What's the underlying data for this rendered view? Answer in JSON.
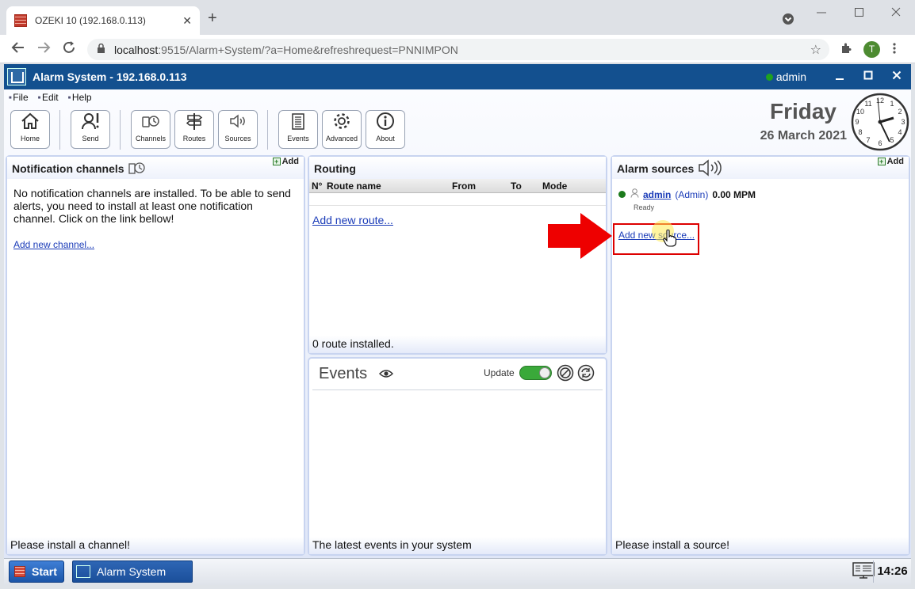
{
  "browser": {
    "tab_title": "OZEKI 10 (192.168.0.113)",
    "tab_close": "✕",
    "new_tab": "+",
    "url_host": "localhost",
    "url_rest": ":9515/Alarm+System/?a=Home&refreshrequest=PNNIMPON",
    "profile_initial": "T"
  },
  "app": {
    "title": "Alarm System - 192.168.0.113",
    "user": "admin",
    "menu": [
      "File",
      "Edit",
      "Help"
    ],
    "toolbar": [
      "Home",
      "Send",
      "Channels",
      "Routes",
      "Sources",
      "Events",
      "Advanced",
      "About"
    ],
    "day": "Friday",
    "date": "26 March 2021"
  },
  "channels": {
    "title": "Notification channels",
    "add": "Add",
    "message": "No notification channels are installed. To be able to send alerts, you need to install at least one notification channel. Click on the link bellow!",
    "link": "Add new channel...",
    "footer": "Please install a channel!"
  },
  "routing": {
    "title": "Routing",
    "columns": [
      "N°",
      "Route name",
      "From",
      "To",
      "Mode"
    ],
    "link": "Add new route...",
    "footer": "0 route installed."
  },
  "events": {
    "title": "Events",
    "update_label": "Update",
    "footer": "The latest events in your system"
  },
  "sources": {
    "title": "Alarm sources",
    "add": "Add",
    "user_name": "admin",
    "user_role": "(Admin)",
    "rate": "0.00 MPM",
    "status": "Ready",
    "link": "Add new source...",
    "footer": "Please install a source!"
  },
  "taskbar": {
    "start": "Start",
    "task": "Alarm System",
    "time": "14:26"
  },
  "colors": {
    "appbar": "#13508f",
    "online": "#1fa21f",
    "highlight_arrow": "#ee0000",
    "highlight_box": "#dd0000",
    "toggle_on": "#3aa93a"
  }
}
